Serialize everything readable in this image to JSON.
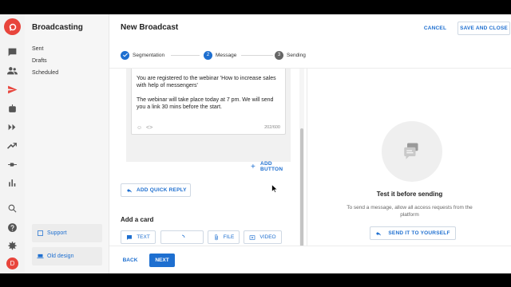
{
  "app": {
    "section_title": "Broadcasting",
    "avatar_initial": "D"
  },
  "rail": {
    "active": "send-icon"
  },
  "section_nav": {
    "items": [
      {
        "label": "Sent"
      },
      {
        "label": "Drafts"
      },
      {
        "label": "Scheduled"
      }
    ],
    "support_label": "Support",
    "old_design_label": "Old design"
  },
  "header": {
    "title": "New Broadcast",
    "cancel_label": "CANCEL",
    "save_label": "SAVE AND CLOSE"
  },
  "stepper": {
    "steps": [
      {
        "number": "1",
        "label": "Segmentation",
        "state": "done"
      },
      {
        "number": "2",
        "label": "Message",
        "state": "active"
      },
      {
        "number": "3",
        "label": "Sending",
        "state": "pending"
      }
    ]
  },
  "editor": {
    "message_line1": "You are registered to the webinar 'How to increase sales with help of messengers'",
    "message_line2": "The webinar will take place today at 7 pm. We will send you a link 30 mins before the start.",
    "char_count": "202/600",
    "add_button_label": "ADD BUTTON",
    "quick_reply_label": "ADD QUICK REPLY",
    "card_title": "Add a card",
    "card_buttons": {
      "text": "TEXT",
      "file": "FILE",
      "video": "VIDEO"
    }
  },
  "preview": {
    "title": "Test it before sending",
    "description": "To send a message, allow all access requests from the platform",
    "send_label": "SEND IT TO YOURSELF"
  },
  "footer": {
    "back_label": "BACK",
    "next_label": "NEXT"
  },
  "colors": {
    "accent": "#1e6fd0",
    "brand": "#e8453c"
  }
}
